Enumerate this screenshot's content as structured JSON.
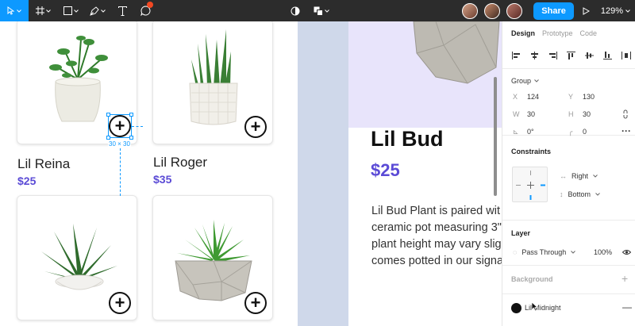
{
  "app": {
    "accent": "#0d99ff",
    "toolbar_bg": "#2c2c2c"
  },
  "toolbar": {
    "tools": [
      "move-tool",
      "frame-tool",
      "shape-tool",
      "pen-tool",
      "text-tool",
      "comment-tool"
    ],
    "share_label": "Share",
    "zoom_label": "129%"
  },
  "products": [
    {
      "name": "Lil Reina",
      "price": "$25"
    },
    {
      "name": "Lil Roger",
      "price": "$35"
    },
    {
      "name": "",
      "price": ""
    },
    {
      "name": "",
      "price": ""
    }
  ],
  "selection": {
    "dimensions": "30 × 30"
  },
  "detail": {
    "title": "Lil Bud",
    "price": "$25",
    "description_lines": [
      "Lil Bud Plant is paired wit",
      "ceramic pot measuring 3\"",
      "plant height may vary slig",
      "comes potted in our signa"
    ]
  },
  "panel": {
    "tabs": [
      "Design",
      "Prototype",
      "Code"
    ],
    "group_label": "Group",
    "fields": {
      "x": "124",
      "y": "130",
      "w": "30",
      "h": "30",
      "rotation": "0°",
      "radius": "0"
    },
    "constraints_title": "Constraints",
    "constraint_h": "Right",
    "constraint_v": "Bottom",
    "layer_title": "Layer",
    "blend_mode": "Pass Through",
    "opacity": "100%",
    "background_title": "Background",
    "fill_name": "Lil Midnight"
  }
}
